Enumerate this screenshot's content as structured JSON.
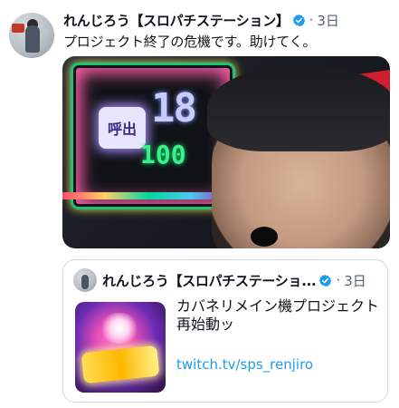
{
  "tweet": {
    "author_name": "れんじろう【スロパチステーション】",
    "separator": "·",
    "time": "3日",
    "text": "プロジェクト終了の危機です。助けてく。",
    "verified": true
  },
  "photo": {
    "call_button_label": "呼出",
    "display_big": "18",
    "display_small": "100"
  },
  "quote_tweet": {
    "author_name": "れんじろう【スロパチステーショ...",
    "separator": "·",
    "time": "3日",
    "verified": true,
    "card_title": "カバネリメイン機プロジェクト再始動ッ",
    "card_link": "twitch.tv/sps_renjiro"
  },
  "icons": {
    "verified_icon": "verified-badge-icon"
  },
  "colors": {
    "verified": "#1d9bf0",
    "link": "#1d9bf0",
    "text": "#0f1419",
    "muted": "#536471",
    "border": "#cfd9de"
  }
}
